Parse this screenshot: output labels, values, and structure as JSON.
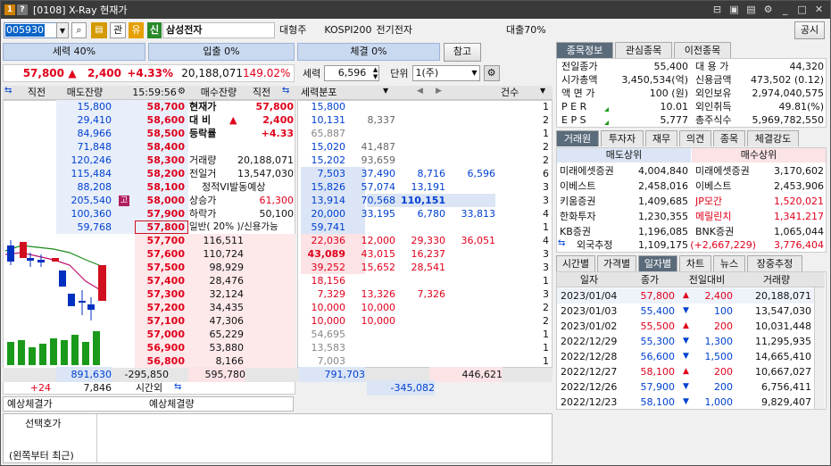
{
  "window": {
    "title": "[0108] X-Ray 현재가",
    "icon1": "1",
    "icon2": "?",
    "close": "✕",
    "disclosure_btn": "공시"
  },
  "toolbar": {
    "code": "005930",
    "cat1": "관",
    "cat2": "유",
    "credit": "신",
    "name": "삼성전자",
    "group": "대형주",
    "index": "KOSPI200",
    "sector": "전기전자",
    "loan": "대출70%"
  },
  "power": {
    "sell": "세력 40%",
    "buy": "입출 0%",
    "exec": "체결 0%",
    "ref": "참고"
  },
  "price": {
    "current": "57,800",
    "arrow": "▲",
    "change": "2,400",
    "rate": "+4.33%",
    "volume": "20,188,071",
    "ratio": "149.02%"
  },
  "seryeok": {
    "label": "세력",
    "value": "6,596",
    "unit_label": "단위",
    "unit": "1(주)"
  },
  "ob_header": {
    "prev": "직전",
    "ask_rem": "매도잔량",
    "time": "15:59:56",
    "bid_rem": "매수잔량",
    "prev2": "직전",
    "dist": "세력분포",
    "count": "건수"
  },
  "asks": [
    {
      "rem": "15,800",
      "price": "58,700"
    },
    {
      "rem": "29,410",
      "price": "58,600"
    },
    {
      "rem": "84,966",
      "price": "58,500"
    },
    {
      "rem": "71,848",
      "price": "58,400"
    },
    {
      "rem": "120,246",
      "price": "58,300"
    },
    {
      "rem": "115,484",
      "price": "58,200"
    },
    {
      "rem": "88,208",
      "price": "58,100"
    },
    {
      "rem": "205,540",
      "price": "58,000",
      "mark": "고"
    },
    {
      "rem": "100,360",
      "price": "57,900"
    },
    {
      "rem": "59,768",
      "price": "57,800"
    }
  ],
  "bids": [
    {
      "price": "57,700",
      "rem": "116,511"
    },
    {
      "price": "57,600",
      "rem": "110,724"
    },
    {
      "price": "57,500",
      "rem": "98,929"
    },
    {
      "price": "57,400",
      "rem": "28,476"
    },
    {
      "price": "57,300",
      "rem": "32,124"
    },
    {
      "price": "57,200",
      "rem": "34,435"
    },
    {
      "price": "57,100",
      "rem": "47,306"
    },
    {
      "price": "57,000",
      "rem": "65,229"
    },
    {
      "price": "56,900",
      "rem": "53,880"
    },
    {
      "price": "56,800",
      "rem": "8,166"
    }
  ],
  "info_rows": [
    {
      "label": "현재가",
      "value": "57,800"
    },
    {
      "label": "대 비",
      "arrow": "▲",
      "value": "2,400"
    },
    {
      "label": "등락률",
      "value": "+4.33"
    },
    {
      "label": "",
      "value": ""
    },
    {
      "label": "거래량",
      "value": "20,188,071"
    },
    {
      "label": "전일거",
      "value": "13,547,030"
    },
    {
      "label": "정적VI발동예상",
      "value": ""
    },
    {
      "label": "상승가",
      "value": "61,300"
    },
    {
      "label": "하락가",
      "value": "50,100"
    },
    {
      "label": "일반( 20% )/신용가능",
      "value": ""
    }
  ],
  "dist_ask": [
    {
      "c1": "15,800",
      "c2": "",
      "c3": "",
      "c4": "",
      "n": "1"
    },
    {
      "c1": "10,131",
      "c2": "8,337",
      "c3": "",
      "c4": "",
      "n": "2"
    },
    {
      "c1": "65,887",
      "c2": "",
      "c3": "",
      "c4": "",
      "n": "1"
    },
    {
      "c1": "15,020",
      "c2": "41,487",
      "c3": "",
      "c4": "",
      "n": "2"
    },
    {
      "c1": "15,202",
      "c2": "93,659",
      "c3": "",
      "c4": "",
      "n": "2"
    },
    {
      "c1": "7,503",
      "c2": "37,490",
      "c3": "8,716",
      "c4": "6,596",
      "n": "6"
    },
    {
      "c1": "15,826",
      "c2": "57,074",
      "c3": "13,191",
      "c4": "",
      "n": "3"
    },
    {
      "c1": "13,914",
      "c2": "70,568",
      "c3": "110,151",
      "c4": "",
      "n": "3"
    },
    {
      "c1": "20,000",
      "c2": "33,195",
      "c3": "6,780",
      "c4": "33,813",
      "n": "4"
    },
    {
      "c1": "59,741",
      "c2": "",
      "c3": "",
      "c4": "",
      "n": "1"
    }
  ],
  "dist_bid": [
    {
      "c1": "22,036",
      "c2": "12,000",
      "c3": "29,330",
      "c4": "36,051",
      "n": "4"
    },
    {
      "c1": "43,089",
      "c2": "43,015",
      "c3": "16,237",
      "c4": "",
      "n": "3"
    },
    {
      "c1": "39,252",
      "c2": "15,652",
      "c3": "28,541",
      "c4": "",
      "n": "3"
    },
    {
      "c1": "18,156",
      "c2": "",
      "c3": "",
      "c4": "",
      "n": "1"
    },
    {
      "c1": "7,329",
      "c2": "13,326",
      "c3": "7,326",
      "c4": "",
      "n": "3"
    },
    {
      "c1": "10,000",
      "c2": "10,000",
      "c3": "",
      "c4": "",
      "n": "2"
    },
    {
      "c1": "10,000",
      "c2": "10,000",
      "c3": "",
      "c4": "",
      "n": "2"
    },
    {
      "c1": "54,695",
      "c2": "",
      "c3": "",
      "c4": "",
      "n": "1"
    },
    {
      "c1": "13,583",
      "c2": "",
      "c3": "",
      "c4": "",
      "n": "1"
    },
    {
      "c1": "7,003",
      "c2": "",
      "c3": "",
      "c4": "",
      "n": "1"
    }
  ],
  "totals": {
    "ask_total": "891,630",
    "diff": "-295,850",
    "bid_total": "595,780",
    "prev_change": "+24",
    "after_hours": "7,846",
    "after_label": "시간외",
    "dist_ask_total": "791,703",
    "dist_bid_total": "446,621",
    "dist_diff": "-345,082"
  },
  "expected": {
    "price_label": "예상체결가",
    "vol_label": "예상체결량"
  },
  "bottom": {
    "line1": "선택호가",
    "line2": "(왼쪽부터 최근)"
  },
  "right_tabs1": [
    "종목정보",
    "관심종목",
    "이전종목"
  ],
  "stock_info": [
    {
      "l": "전일종가",
      "v": "55,400",
      "l2": "대 용 가",
      "v2": "44,320"
    },
    {
      "l": "시가총액",
      "v": "3,450,534(억)",
      "l2": "신용금액",
      "v2": "473,502  (0.12)"
    },
    {
      "l": "액 면 가",
      "v": "100 (원)",
      "l2": "외인보유",
      "v2": "2,974,040,575"
    },
    {
      "l": "P E R",
      "v": "10.01",
      "l2": "외인취득",
      "v2": "49.81(%)"
    },
    {
      "l": "E P S",
      "v": "5,777",
      "l2": "총주식수",
      "v2": "5,969,782,550"
    }
  ],
  "right_tabs2": [
    "거래원",
    "투자자",
    "재무",
    "의견",
    "종목",
    "체결강도"
  ],
  "broker_hdr": {
    "sell": "매도상위",
    "buy": "매수상위"
  },
  "brokers": [
    {
      "s": "미래에셋증권",
      "sv": "4,004,840",
      "b": "미래에셋증권",
      "bv": "3,170,602",
      "bred": false
    },
    {
      "s": "이베스트",
      "sv": "2,458,016",
      "b": "이베스트",
      "bv": "2,453,906",
      "bred": false
    },
    {
      "s": "키움증권",
      "sv": "1,409,685",
      "b": "JP모간",
      "bv": "1,520,021",
      "bred": true
    },
    {
      "s": "한화투자",
      "sv": "1,230,355",
      "b": "메릴린치",
      "bv": "1,341,217",
      "bred": true
    },
    {
      "s": "KB증권",
      "sv": "1,196,085",
      "b": "BNK증권",
      "bv": "1,065,044",
      "bred": false
    }
  ],
  "foreign": {
    "label": "외국추정",
    "sv": "1,109,175",
    "diff": "(+2,667,229)",
    "bv": "3,776,404"
  },
  "right_tabs3": [
    "시간별",
    "가격별",
    "일자별",
    "차트",
    "뉴스",
    "장중추정"
  ],
  "daily_hdr": {
    "d": "일자",
    "p": "종가",
    "c": "전일대비",
    "v": "거래량"
  },
  "daily": [
    {
      "d": "2023/01/04",
      "p": "57,800",
      "a": "▲",
      "c": "2,400",
      "v": "20,188,071",
      "up": true
    },
    {
      "d": "2023/01/03",
      "p": "55,400",
      "a": "▼",
      "c": "100",
      "v": "13,547,030",
      "up": false
    },
    {
      "d": "2023/01/02",
      "p": "55,500",
      "a": "▲",
      "c": "200",
      "v": "10,031,448",
      "up": true
    },
    {
      "d": "2022/12/29",
      "p": "55,300",
      "a": "▼",
      "c": "1,300",
      "v": "11,295,935",
      "up": false
    },
    {
      "d": "2022/12/28",
      "p": "56,600",
      "a": "▼",
      "c": "1,500",
      "v": "14,665,410",
      "up": false
    },
    {
      "d": "2022/12/27",
      "p": "58,100",
      "a": "▲",
      "c": "200",
      "v": "10,667,027",
      "up": true
    },
    {
      "d": "2022/12/26",
      "p": "57,900",
      "a": "▼",
      "c": "200",
      "v": "6,756,411",
      "up": false
    },
    {
      "d": "2022/12/23",
      "p": "58,100",
      "a": "▼",
      "c": "1,000",
      "v": "9,829,407",
      "up": false
    }
  ],
  "colors": {
    "up": "#e0001b",
    "down": "#0040d0",
    "title": "#3a3a3a",
    "tab_on": "#5a6b7b"
  }
}
